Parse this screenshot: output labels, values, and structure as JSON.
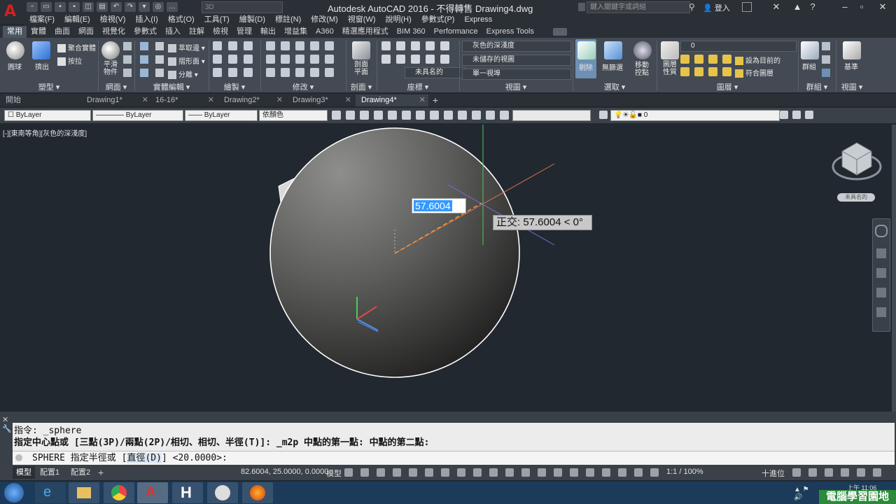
{
  "window": {
    "title": "Autodesk AutoCAD 2016 - 不得轉售    Drawing4.dwg",
    "workspace_combo": "3D",
    "search_placeholder": "鍵入關鍵字或詞組",
    "login_label": "登入"
  },
  "menubar": [
    "檔案(F)",
    "編輯(E)",
    "檢視(V)",
    "插入(I)",
    "格式(O)",
    "工具(T)",
    "繪製(D)",
    "標註(N)",
    "修改(M)",
    "視窗(W)",
    "說明(H)",
    "參數式(P)",
    "Express"
  ],
  "ribbon_tabs": [
    "常用",
    "實體",
    "曲面",
    "網面",
    "視覺化",
    "參數式",
    "插入",
    "註解",
    "檢視",
    "管理",
    "輸出",
    "增益集",
    "A360",
    "精選應用程式",
    "BIM 360",
    "Performance",
    "Express Tools"
  ],
  "ribbon": {
    "buttons": {
      "box": "圓球",
      "extrude": "擠出",
      "union": "聚合實體",
      "presspull": "按拉",
      "smooth": "平滑物件",
      "extract_edges": "萃取邊",
      "shape_sep": "摺形面",
      "separate": "分離",
      "section_plane": "剖面平面",
      "no_filter": "無篩選",
      "move_gizmo": "移動控點",
      "layer_props": "圖層性質",
      "group": "群組",
      "base": "基準",
      "cull": "剔除"
    },
    "combos": {
      "visual_style": "灰色的深淺度",
      "saved_view": "未儲存的視圖",
      "viewport": "單一視埠",
      "named_ucs": "未具名的",
      "layer_combo": "0",
      "set_current": "設為目前的",
      "match_layer": "符合圖層"
    },
    "panels": [
      "塑型",
      "網面",
      "實體編輯",
      "繪製",
      "修改",
      "剖面",
      "座標",
      "視圖",
      "選取",
      "圖層",
      "群組",
      "視圖"
    ]
  },
  "doc_tabs": [
    {
      "label": "開始",
      "active": false
    },
    {
      "label": "Drawing1*",
      "active": false
    },
    {
      "label": "16-16*",
      "active": false
    },
    {
      "label": "Drawing2*",
      "active": false
    },
    {
      "label": "Drawing3*",
      "active": false
    },
    {
      "label": "Drawing4*",
      "active": true
    }
  ],
  "properties": {
    "color": "ByLayer",
    "linetype": "ByLayer",
    "lineweight": "ByLayer",
    "plotstyle": "依顏色",
    "layer": "0"
  },
  "viewport": {
    "label": "[-][東南等角][灰色的深淺度]",
    "input_value": "57.6004",
    "tooltip": "正交: 57.6004 < 0°",
    "viewcube_label": "未具名的"
  },
  "command": {
    "history": [
      "指令: _sphere",
      "指定中心點或 [三點(3P)/兩點(2P)/相切、相切、半徑(T)]: _m2p 中點的第一點: 中點的第二點:"
    ],
    "prompt_prefix": "SPHERE 指定半徑或 [",
    "prompt_option": "直徑(D)",
    "prompt_suffix": "] <20.0000>:"
  },
  "statusbar": {
    "layout_tabs": [
      "模型",
      "配置1",
      "配置2"
    ],
    "coordinates": "82.6004, 25.0000, 0.0000",
    "model_label": "模型",
    "scale": "1:1 / 100%",
    "units": "十進位"
  },
  "taskbar": {
    "clock": "上午 11:06",
    "watermark": "電腦學習園地"
  }
}
